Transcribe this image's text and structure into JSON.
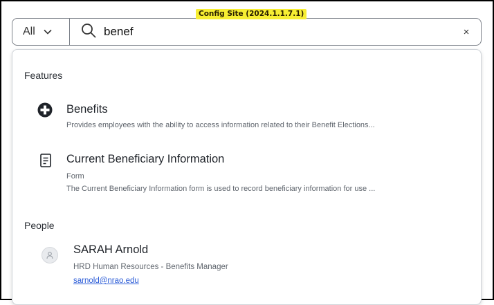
{
  "config_badge": "Config Site (2024.1.1.7.1)",
  "search": {
    "scope_label": "All",
    "query": "benef",
    "clear_label": "×"
  },
  "sections": {
    "features_title": "Features",
    "people_title": "People"
  },
  "features": [
    {
      "icon": "plus-circle-icon",
      "title": "Benefits",
      "subtitle": "Provides employees with the ability to access information related to their Benefit Elections..."
    },
    {
      "icon": "form-document-icon",
      "title": "Current Beneficiary Information",
      "type": "Form",
      "subtitle": "The Current Beneficiary Information form is used to record beneficiary information for use ..."
    }
  ],
  "people": [
    {
      "icon": "user-avatar-icon",
      "name": "SARAH Arnold",
      "role": "HRD Human Resources - Benefits Manager",
      "email": "sarnold@nrao.edu"
    }
  ]
}
